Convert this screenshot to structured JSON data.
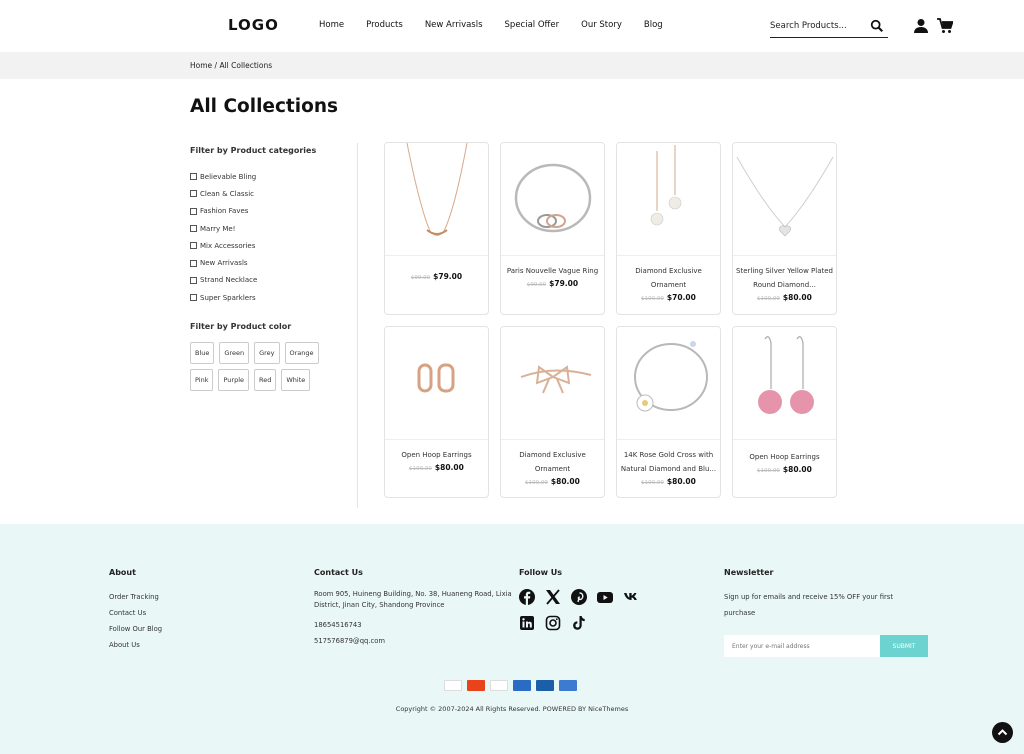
{
  "header": {
    "logo": "LOGO",
    "nav": [
      "Home",
      "Products",
      "New Arrivasls",
      "Special Offer",
      "Our Story",
      "Blog"
    ],
    "search_placeholder": "Search Products..."
  },
  "breadcrumb": "Home / All Collections",
  "page_title": "All Collections",
  "filters": {
    "categories_heading": "Filter by Product categories",
    "categories": [
      "Believable Bling",
      "Clean & Classic",
      "Fashion Faves",
      "Marry Me!",
      "Mix Accessories",
      "New Arrivasls",
      "Strand Necklace",
      "Super Sparklers"
    ],
    "color_heading": "Filter by Product color",
    "colors": [
      "Blue",
      "Green",
      "Grey",
      "Orange",
      "Pink",
      "Purple",
      "Red",
      "White"
    ]
  },
  "products": [
    {
      "name": "",
      "old_price": "$99.00",
      "price": "$79.00",
      "image": "rose-gold-necklace"
    },
    {
      "name": "Paris Nouvelle Vague Ring",
      "old_price": "$99.00",
      "price": "$79.00",
      "image": "silver-bracelet"
    },
    {
      "name": "Diamond Exclusive Ornament",
      "old_price": "$100.00",
      "price": "$70.00",
      "image": "pearl-drop-earrings"
    },
    {
      "name": "Sterling Silver Yellow Plated Round Diamond...",
      "old_price": "$100.00",
      "price": "$80.00",
      "image": "silver-heart-necklace"
    },
    {
      "name": "Open Hoop Earrings",
      "old_price": "$100.00",
      "price": "$80.00",
      "image": "gold-hoop-earrings"
    },
    {
      "name": "Diamond Exclusive Ornament",
      "old_price": "$100.00",
      "price": "$80.00",
      "image": "bow-bangle"
    },
    {
      "name": "14K Rose Gold Cross with Natural Diamond and Blu...",
      "old_price": "$100.00",
      "price": "$80.00",
      "image": "flower-bracelet"
    },
    {
      "name": "Open Hoop Earrings",
      "old_price": "$100.00",
      "price": "$80.00",
      "image": "pink-ball-earrings"
    }
  ],
  "footer": {
    "about_heading": "About",
    "about_links": [
      "Order Tracking",
      "Contact Us",
      "Follow Our Blog",
      "About Us"
    ],
    "contact_heading": "Contact Us",
    "address": "Room 905, Huineng Building, No. 38, Huaneng Road, Lixia District, Jinan City, Shandong Province",
    "phone": "18654516743",
    "email": "517576879@qq.com",
    "follow_heading": "Follow Us",
    "social": [
      "facebook-icon",
      "x-icon",
      "pinterest-icon",
      "youtube-icon",
      "vk-icon",
      "linkedin-icon",
      "instagram-icon",
      "tiktok-icon"
    ],
    "newsletter_heading": "Newsletter",
    "newsletter_text": "Sign up for emails and receive 15% OFF your first purchase",
    "newsletter_placeholder": "Enter your e-mail address",
    "submit_label": "SUBMIT",
    "payments": [
      "VISA",
      "MasterCard",
      "PayPal",
      "American Express",
      "PIN Electron",
      "Maestro"
    ],
    "copyright": "Copyright © 2007-2024 All Rights Reserved. POWERED BY NiceThemes"
  },
  "colors": {
    "accent": "#6dd3d0",
    "footer_bg": "#eaf7f7",
    "crumb_bg": "#f2f2f2"
  }
}
